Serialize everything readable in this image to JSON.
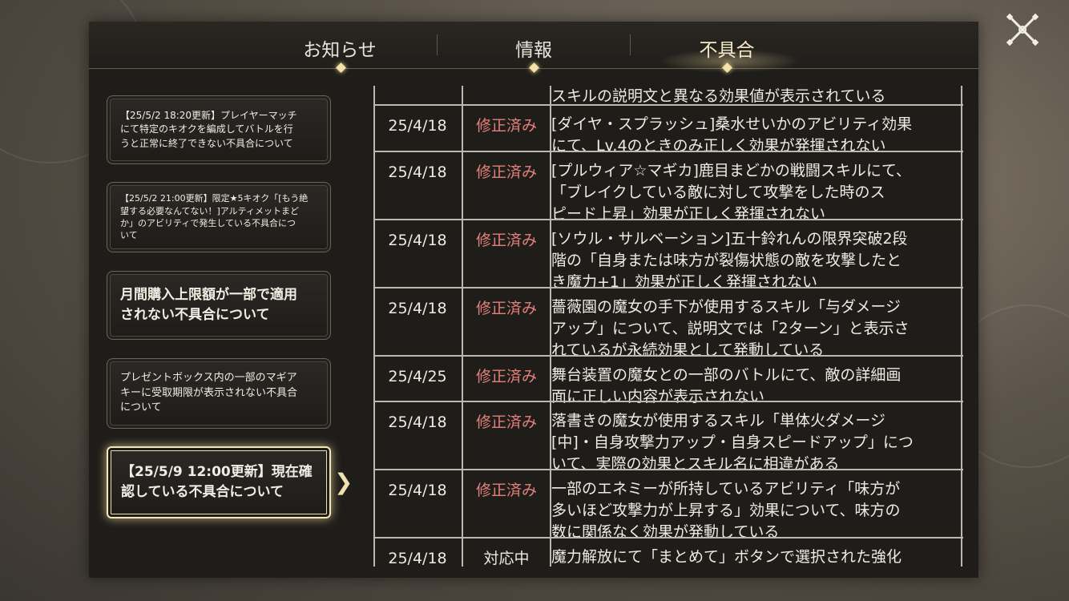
{
  "tabs": [
    {
      "label": "お知らせ",
      "active": false
    },
    {
      "label": "情報",
      "active": false
    },
    {
      "label": "不具合",
      "active": true
    }
  ],
  "notices": [
    {
      "lines": [
        "【25/5/2 18:20更新】プレイヤーマッチ",
        "にて特定のキオクを編成してバトルを行",
        "うと正常に終了できない不具合について"
      ],
      "size": "small",
      "active": false
    },
    {
      "lines": [
        "【25/5/2 21:00更新】限定★5キオク「[もう絶",
        "望する必要なんてない！]アルティメットまど",
        "か」のアビリティで発生している不具合につ",
        "いて"
      ],
      "size": "small",
      "active": false
    },
    {
      "lines": [
        "月間購入上限額が一部で適用",
        "されない不具合について"
      ],
      "size": "large",
      "active": false
    },
    {
      "lines": [
        "プレゼントボックス内の一部のマギア",
        "キーに受取期限が表示されない不具合",
        "について"
      ],
      "size": "small",
      "active": false
    },
    {
      "lines": [
        "【25/5/9 12:00更新】現在確",
        "認している不具合について"
      ],
      "size": "large",
      "active": true
    }
  ],
  "table": {
    "rows": [
      {
        "date": "",
        "status": "",
        "status_type": "",
        "desc": "スキルの説明文と異なる効果値が表示されている"
      },
      {
        "date": "25/4/18",
        "status": "修正済み",
        "status_type": "fixed",
        "desc": "[ダイヤ・スプラッシュ]桑水せいかのアビリティ効果\nにて、Lv.4のときのみ正しく効果が発揮されない"
      },
      {
        "date": "25/4/18",
        "status": "修正済み",
        "status_type": "fixed",
        "desc": "[プルウィア☆マギカ]鹿目まどかの戦闘スキルにて、\n「ブレイクしている敵に対して攻撃をした時のス\nピード上昇」効果が正しく発揮されない"
      },
      {
        "date": "25/4/18",
        "status": "修正済み",
        "status_type": "fixed",
        "desc": "[ソウル・サルベーション]五十鈴れんの限界突破2段\n階の「自身または味方が裂傷状態の敵を攻撃したと\nき魔力+1」効果が正しく発揮されない"
      },
      {
        "date": "25/4/18",
        "status": "修正済み",
        "status_type": "fixed",
        "desc": "薔薇園の魔女の手下が使用するスキル「与ダメージ\nアップ」について、説明文では「2ターン」と表示さ\nれているが永続効果として発動している"
      },
      {
        "date": "25/4/25",
        "status": "修正済み",
        "status_type": "fixed",
        "desc": "舞台装置の魔女との一部のバトルにて、敵の詳細画\n面に正しい内容が表示されない"
      },
      {
        "date": "25/4/18",
        "status": "修正済み",
        "status_type": "fixed",
        "desc": "落書きの魔女が使用するスキル「単体火ダメージ\n[中]・自身攻撃力アップ・自身スピードアップ」につ\nいて、実際の効果とスキル名に相違がある"
      },
      {
        "date": "25/4/18",
        "status": "修正済み",
        "status_type": "fixed",
        "desc": "一部のエネミーが所持しているアビリティ「味方が\n多いほど攻撃力が上昇する」効果について、味方の\n数に関係なく効果が発動している"
      },
      {
        "date": "25/4/18",
        "status": "対応中",
        "status_type": "pending",
        "desc": "魔力解放にて「まとめて」ボタンで選択された強化"
      }
    ]
  },
  "colors": {
    "fixed": "#e4807a",
    "pending": "#efebe2",
    "accent": "#f4e6b6"
  },
  "icons": {
    "close": "close-x-icon",
    "arrow": "chevron-right-icon"
  }
}
